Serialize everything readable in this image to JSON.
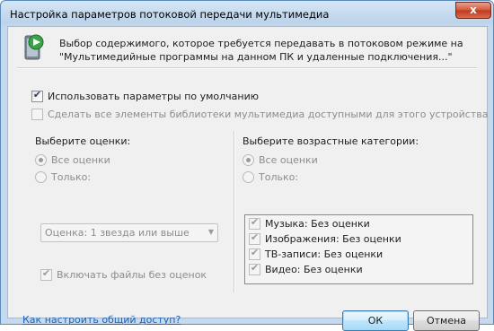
{
  "window": {
    "title": "Настройка параметров потоковой передачи мультимедиа",
    "close_glyph": "x"
  },
  "header": {
    "icon": "media-streaming-icon",
    "line1": "Выбор содержимого, которое требуется передавать в потоковом режиме на",
    "line2": "\"Мультимедийные программы на данном ПК и удаленные подключения...\""
  },
  "options": {
    "use_defaults": {
      "label": "Использовать параметры по умолчанию",
      "checked": true
    },
    "make_all_available": {
      "label": "Сделать все элементы библиотеки мультимедиа доступными для этого устройства",
      "checked": false,
      "enabled": false
    }
  },
  "ratings": {
    "heading": "Выберите оценки:",
    "all_label": "Все оценки",
    "only_label": "Только:",
    "dropdown_value": "Оценка: 1 звезда или выше",
    "include_unrated_label": "Включать файлы без оценок",
    "include_unrated_checked": true
  },
  "parental": {
    "heading": "Выберите возрастные категории:",
    "all_label": "Все оценки",
    "only_label": "Только:",
    "items": [
      {
        "label": "Музыка: Без оценки",
        "checked": true
      },
      {
        "label": "Изображения: Без оценки",
        "checked": true
      },
      {
        "label": "ТВ-записи: Без оценки",
        "checked": true
      },
      {
        "label": "Видео: Без оценки",
        "checked": true
      }
    ]
  },
  "footer": {
    "help_link": "Как настроить общий доступ?",
    "ok_label": "ОК",
    "cancel_label": "Отмена"
  },
  "colors": {
    "frame": "#c5daee",
    "link": "#1d62b8",
    "close_button": "#c2391e"
  }
}
